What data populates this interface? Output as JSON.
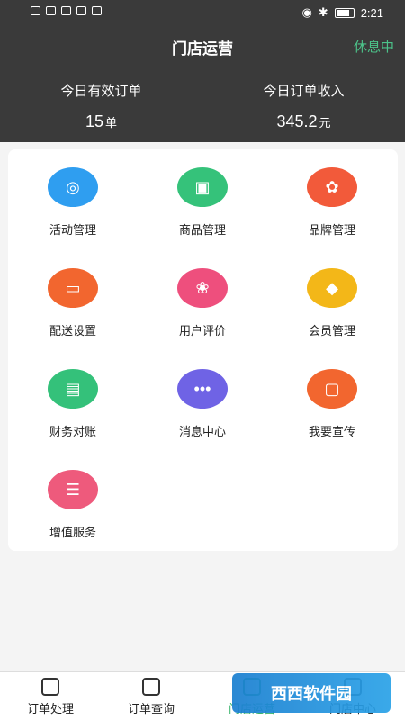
{
  "statusbar": {
    "time": "2:21"
  },
  "header": {
    "title": "门店运营",
    "status": "休息中",
    "stats": [
      {
        "label": "今日有效订单",
        "value": "15",
        "unit": "单"
      },
      {
        "label": "今日订单收入",
        "value": "345.2",
        "unit": "元"
      }
    ]
  },
  "grid": {
    "tiles": [
      {
        "label": "活动管理",
        "icon": "activity-icon",
        "color": "#2f9ef0"
      },
      {
        "label": "商品管理",
        "icon": "gift-icon",
        "color": "#35c27a"
      },
      {
        "label": "品牌管理",
        "icon": "ribbon-icon",
        "color": "#f25a3a"
      },
      {
        "label": "配送设置",
        "icon": "truck-icon",
        "color": "#f2662f"
      },
      {
        "label": "用户评价",
        "icon": "flower-icon",
        "color": "#ee4f7d"
      },
      {
        "label": "会员管理",
        "icon": "diamond-icon",
        "color": "#f3b718"
      },
      {
        "label": "财务对账",
        "icon": "wallet-icon",
        "color": "#34c17a"
      },
      {
        "label": "消息中心",
        "icon": "chat-icon",
        "color": "#6f63e5"
      },
      {
        "label": "我要宣传",
        "icon": "billboard-icon",
        "color": "#f2662f"
      },
      {
        "label": "增值服务",
        "icon": "coin-icon",
        "color": "#ee5a7c"
      }
    ]
  },
  "tabbar": {
    "tabs": [
      {
        "label": "订单处理"
      },
      {
        "label": "订单查询"
      },
      {
        "label": "门店运营"
      },
      {
        "label": "门店中心"
      }
    ]
  },
  "watermark": {
    "text": "西西软件园"
  }
}
